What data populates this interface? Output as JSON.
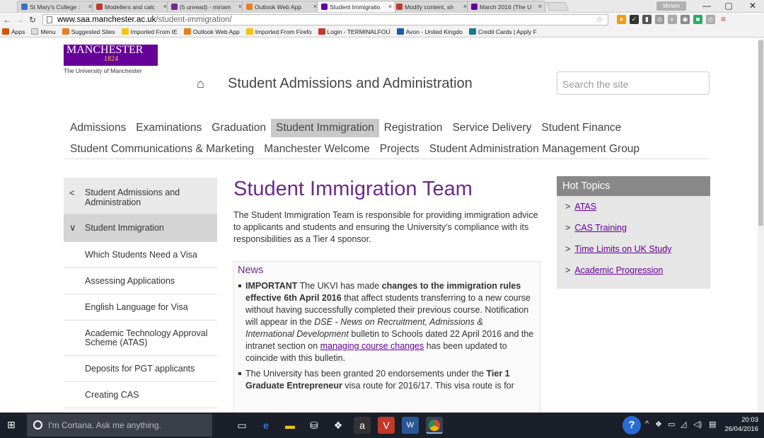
{
  "browser": {
    "tabs": [
      {
        "title": "St Mary's College :",
        "color": "#3b6fc4"
      },
      {
        "title": "Modellers and calc",
        "color": "#c0392b"
      },
      {
        "title": "(5 unread) - miriam",
        "color": "#6b2c91"
      },
      {
        "title": "Outlook Web App",
        "color": "#e67e22"
      },
      {
        "title": "Student Immigratio",
        "color": "#660099"
      },
      {
        "title": "Modify content, sh",
        "color": "#c0392b"
      },
      {
        "title": "March 2016 (The U",
        "color": "#660099"
      }
    ],
    "user_badge": "Miriam",
    "window_controls": {
      "minimize": "—",
      "maximize": "▢",
      "close": "✕"
    },
    "url_host": "www.saa.manchester.ac.uk",
    "url_path": "/student-immigration/",
    "bookmarks": [
      {
        "label": "Apps",
        "color": "#d35400"
      },
      {
        "label": "Menu",
        "color": "#999999"
      },
      {
        "label": "Suggested Sites",
        "color": "#e67e22"
      },
      {
        "label": "Imported From IE",
        "color": "#f1c40f"
      },
      {
        "label": "Outlook Web App",
        "color": "#e67e22"
      },
      {
        "label": "Imported From Firefo",
        "color": "#f1c40f"
      },
      {
        "label": "Login - TERMINALFOU",
        "color": "#c0392b"
      },
      {
        "label": "Avon - United Kingdo",
        "color": "#1a5aa8"
      },
      {
        "label": "Credit Cards | Apply F",
        "color": "#1a7a8a"
      }
    ]
  },
  "site": {
    "logo_name": "MANCHESTER",
    "logo_year": "1824",
    "logo_university": "The University of Manchester",
    "title": "Student Admissions and Administration",
    "search_placeholder": "Search the site",
    "nav_row1": [
      "Admissions",
      "Examinations",
      "Graduation",
      "Student Immigration",
      "Registration",
      "Service Delivery",
      "Student Finance"
    ],
    "nav_row2": [
      "Student Communications & Marketing",
      "Manchester Welcome",
      "Projects",
      "Student Administration Management Group"
    ],
    "active_nav": "Student Immigration"
  },
  "leftnav": {
    "back": "Student Admissions and Administration",
    "parent": "Student Immigration",
    "items": [
      "Which Students Need a Visa",
      "Assessing Applications",
      "English Language for Visa",
      "Academic Technology Approval Scheme (ATAS)",
      "Deposits for PGT applicants",
      "Creating CAS"
    ]
  },
  "main": {
    "title": "Student Immigration Team",
    "intro": "The Student Immigration Team is responsible for providing immigration advice to applicants and students and ensuring the University's compliance with its responsibilities as a Tier 4 sponsor.",
    "news_heading": "News",
    "news1": {
      "bold1": "IMPORTANT",
      "t1": " The UKVI has made ",
      "bold2": "changes to the immigration rules effective 6th April 2016",
      "t2": " that affect students transferring to a new course without having successfully completed their previous course. Notification will appear in the ",
      "em": "DSE - News on Recruitment, Admissions & International Development",
      "t3": " bulletin to Schools dated 22 April 2016 and the intranet section on ",
      "link": "managing course changes",
      "t4": " has been updated to coincide with this bulletin."
    },
    "news2": {
      "t1": "The University has been granted 20 endorsements under the ",
      "bold": "Tier 1 Graduate Entrepreneur",
      "t2": " visa route for 2016/17. This visa route is for"
    }
  },
  "hot_topics": {
    "heading": "Hot Topics",
    "items": [
      "ATAS",
      "CAS Training",
      "Time Limits on UK Study",
      "Academic Progression"
    ]
  },
  "taskbar": {
    "cortana": "I'm Cortana. Ask me anything.",
    "time": "20:03",
    "date": "26/04/2016"
  }
}
